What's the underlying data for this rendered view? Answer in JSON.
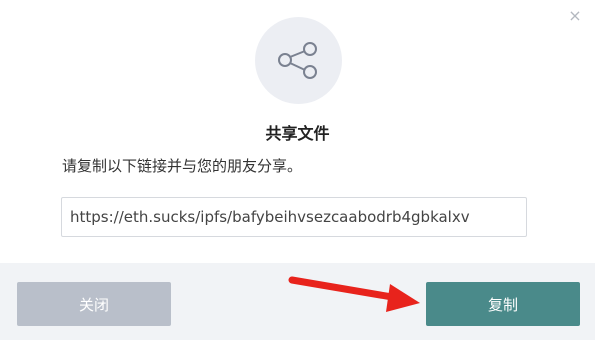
{
  "dialog": {
    "close_glyph": "×",
    "title": "共享文件",
    "instruction": "请复制以下链接并与您的朋友分享。",
    "link_value": "https://eth.sucks/ipfs/bafybeihvsezcaabodrb4gbkalxv",
    "share_icon": "share-icon"
  },
  "footer": {
    "close_label": "关闭",
    "copy_label": "复制"
  },
  "colors": {
    "copy_button": "#4a8a8a",
    "close_button": "#b9bfca",
    "annotation_arrow": "#e8231c"
  }
}
